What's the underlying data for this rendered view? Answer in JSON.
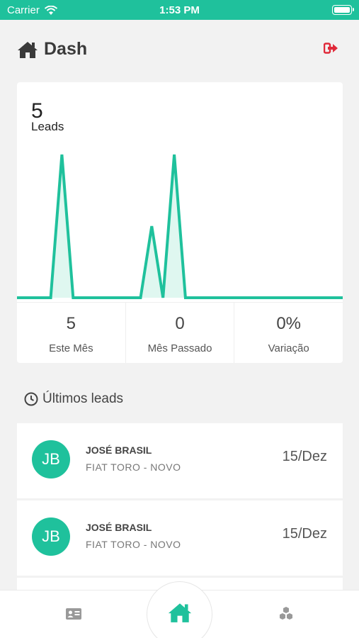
{
  "status_bar": {
    "carrier": "Carrier",
    "time": "1:53 PM"
  },
  "header": {
    "title": "Dash",
    "icon": "home-icon",
    "logout_icon": "sign-out-icon"
  },
  "summary": {
    "count": "5",
    "count_label": "Leads",
    "stats": [
      {
        "value": "5",
        "label": "Este Mês"
      },
      {
        "value": "0",
        "label": "Mês Passado"
      },
      {
        "value": "0%",
        "label": "Variação"
      }
    ]
  },
  "chart_data": {
    "type": "area",
    "x": [
      0,
      1,
      2,
      3,
      4,
      5,
      6,
      7,
      8,
      9,
      10,
      11,
      12,
      13,
      14,
      15,
      16,
      17,
      18,
      19,
      20,
      21,
      22,
      23,
      24,
      25,
      26,
      27,
      28,
      29
    ],
    "values": [
      0,
      0,
      0,
      0,
      2,
      0,
      0,
      0,
      0,
      0,
      0,
      0,
      1,
      0,
      2,
      0,
      0,
      0,
      0,
      0,
      0,
      0,
      0,
      0,
      0,
      0,
      0,
      0,
      0,
      0
    ],
    "ylim": [
      0,
      2
    ],
    "grid": false,
    "color": "#1fc19c",
    "fill_color": "#dff7f0"
  },
  "recent": {
    "title": "Últimos leads",
    "icon": "clock-icon",
    "items": [
      {
        "initials": "JB",
        "name": "JOSÉ BRASIL",
        "car": "FIAT TORO - NOVO",
        "date": "15/Dez"
      },
      {
        "initials": "JB",
        "name": "JOSÉ BRASIL",
        "car": "FIAT TORO - NOVO",
        "date": "15/Dez"
      }
    ]
  },
  "tabbar": {
    "left_icon": "id-card-icon",
    "center_icon": "home-icon",
    "right_icon": "cubes-icon",
    "accent": "#1fc19c"
  }
}
